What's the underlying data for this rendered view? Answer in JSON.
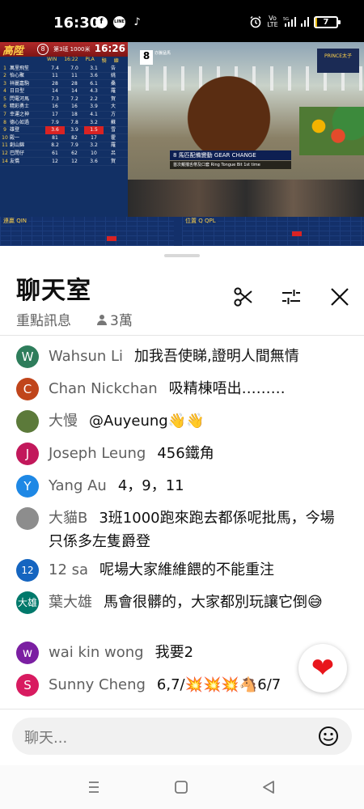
{
  "status_bar": {
    "time": "16:30",
    "apps": [
      "f",
      "LINE",
      "♪"
    ],
    "network_label": "Vo LTE",
    "signal_label": "5G",
    "battery_level": "7"
  },
  "video": {
    "logo": "高陞",
    "race_number": "8",
    "race_info": "第3班 1000米",
    "clock": "16:26",
    "column_headers": [
      "WIN",
      "16:22",
      "PLA",
      "騎",
      "練"
    ],
    "runners": [
      {
        "no": "1",
        "name": "萬里飛笙",
        "win": "7.4",
        "pla": "7.0",
        "v1": "3.1",
        "v2": "告"
      },
      {
        "no": "2",
        "name": "怡心聚",
        "win": "11",
        "pla": "11",
        "v1": "3.6",
        "v2": "姚"
      },
      {
        "no": "3",
        "name": "祥麗嘉駒",
        "win": "28",
        "pla": "28",
        "v1": "6.1",
        "v2": "桑"
      },
      {
        "no": "4",
        "name": "日日型",
        "win": "14",
        "pla": "14",
        "v1": "4.3",
        "v2": "羅"
      },
      {
        "no": "5",
        "name": "閃電河馬",
        "win": "7.3",
        "pla": "7.2",
        "v1": "2.2",
        "v2": "賀"
      },
      {
        "no": "6",
        "name": "精彩勇士",
        "win": "16",
        "pla": "16",
        "v1": "3.9",
        "v2": "大"
      },
      {
        "no": "7",
        "name": "幸運之神",
        "win": "17",
        "pla": "18",
        "v1": "4.1",
        "v2": "方"
      },
      {
        "no": "8",
        "name": "德心如過",
        "win": "7.9",
        "pla": "7.8",
        "v1": "3.2",
        "v2": "蘇"
      },
      {
        "no": "9",
        "name": "雄登",
        "win": "3.6",
        "pla": "3.9",
        "v1": "1.5",
        "v2": "雪"
      },
      {
        "no": "10",
        "name": "殿一",
        "win": "81",
        "pla": "82",
        "v1": "17",
        "v2": "霍"
      },
      {
        "no": "11",
        "name": "創山錦",
        "win": "8.2",
        "pla": "7.9",
        "v1": "3.2",
        "v2": "羅"
      },
      {
        "no": "12",
        "name": "巴閉仔",
        "win": "61",
        "pla": "62",
        "v1": "10",
        "v2": "呂"
      },
      {
        "no": "14",
        "name": "友僑",
        "win": "12",
        "pla": "12",
        "v1": "3.6",
        "v2": "賀"
      }
    ],
    "saddle_number": "8",
    "scene_tag": "亦騰猛馬",
    "sponsor": "PRINCE太子",
    "gear_banner": "8 馬匹配備變動 GEAR CHANGE",
    "gear_sub": "首次戴擋舌帶及口套 Ring Tongue Bit 1st time",
    "left_table_title": "連贏 QIN",
    "right_table_title": "位置 Q QPL"
  },
  "header": {
    "title": "聊天室",
    "subtitle": "重點訊息",
    "viewer_count": "3萬"
  },
  "messages": [
    {
      "author": "Wahsun Li",
      "text": "加我吾使睇,證明人間無情",
      "avatar_letter": "W",
      "avatar_color": "#2e7d5b"
    },
    {
      "author": "Chan Nickchan",
      "text": "吸精棟唔出………",
      "avatar_letter": "C",
      "avatar_color": "#c0451b"
    },
    {
      "author": "大慢",
      "text": "@Auyeung👋👋",
      "avatar_letter": "",
      "avatar_color": "#5c7a3a"
    },
    {
      "author": "Joseph Leung",
      "text": "456鐵角",
      "avatar_letter": "J",
      "avatar_color": "#c2185b"
    },
    {
      "author": "Yang Au",
      "text": "4，9，11",
      "avatar_letter": "Y",
      "avatar_color": "#1e88e5"
    },
    {
      "author": "大貓B",
      "text": "3班1000跑來跑去都係呢批馬，今場只係多左隻爵登",
      "avatar_letter": "",
      "avatar_color": "#8d8d8d"
    },
    {
      "author": "12 sa",
      "text": "呢場大家維維餵的不能重注",
      "avatar_letter": "12",
      "avatar_color": "#1565c0"
    },
    {
      "author": "葉大雄",
      "text": "馬會很髒的，大家都別玩讓它倒😅",
      "avatar_letter": "大雄",
      "avatar_color": "#00796b"
    },
    {
      "author": "wai kin wong",
      "text": "我要2",
      "avatar_letter": "w",
      "avatar_color": "#7b1fa2"
    },
    {
      "author": "Sunny Cheng",
      "text": "6,7/💥💥💥🐴6/7",
      "avatar_letter": "S",
      "avatar_color": "#d81b60"
    }
  ],
  "heart_icon": "❤",
  "input": {
    "placeholder": "聊天..."
  },
  "colors": {
    "accent_red": "#e8161c",
    "video_panel": "#123065",
    "highlight_red": "#d92323"
  }
}
